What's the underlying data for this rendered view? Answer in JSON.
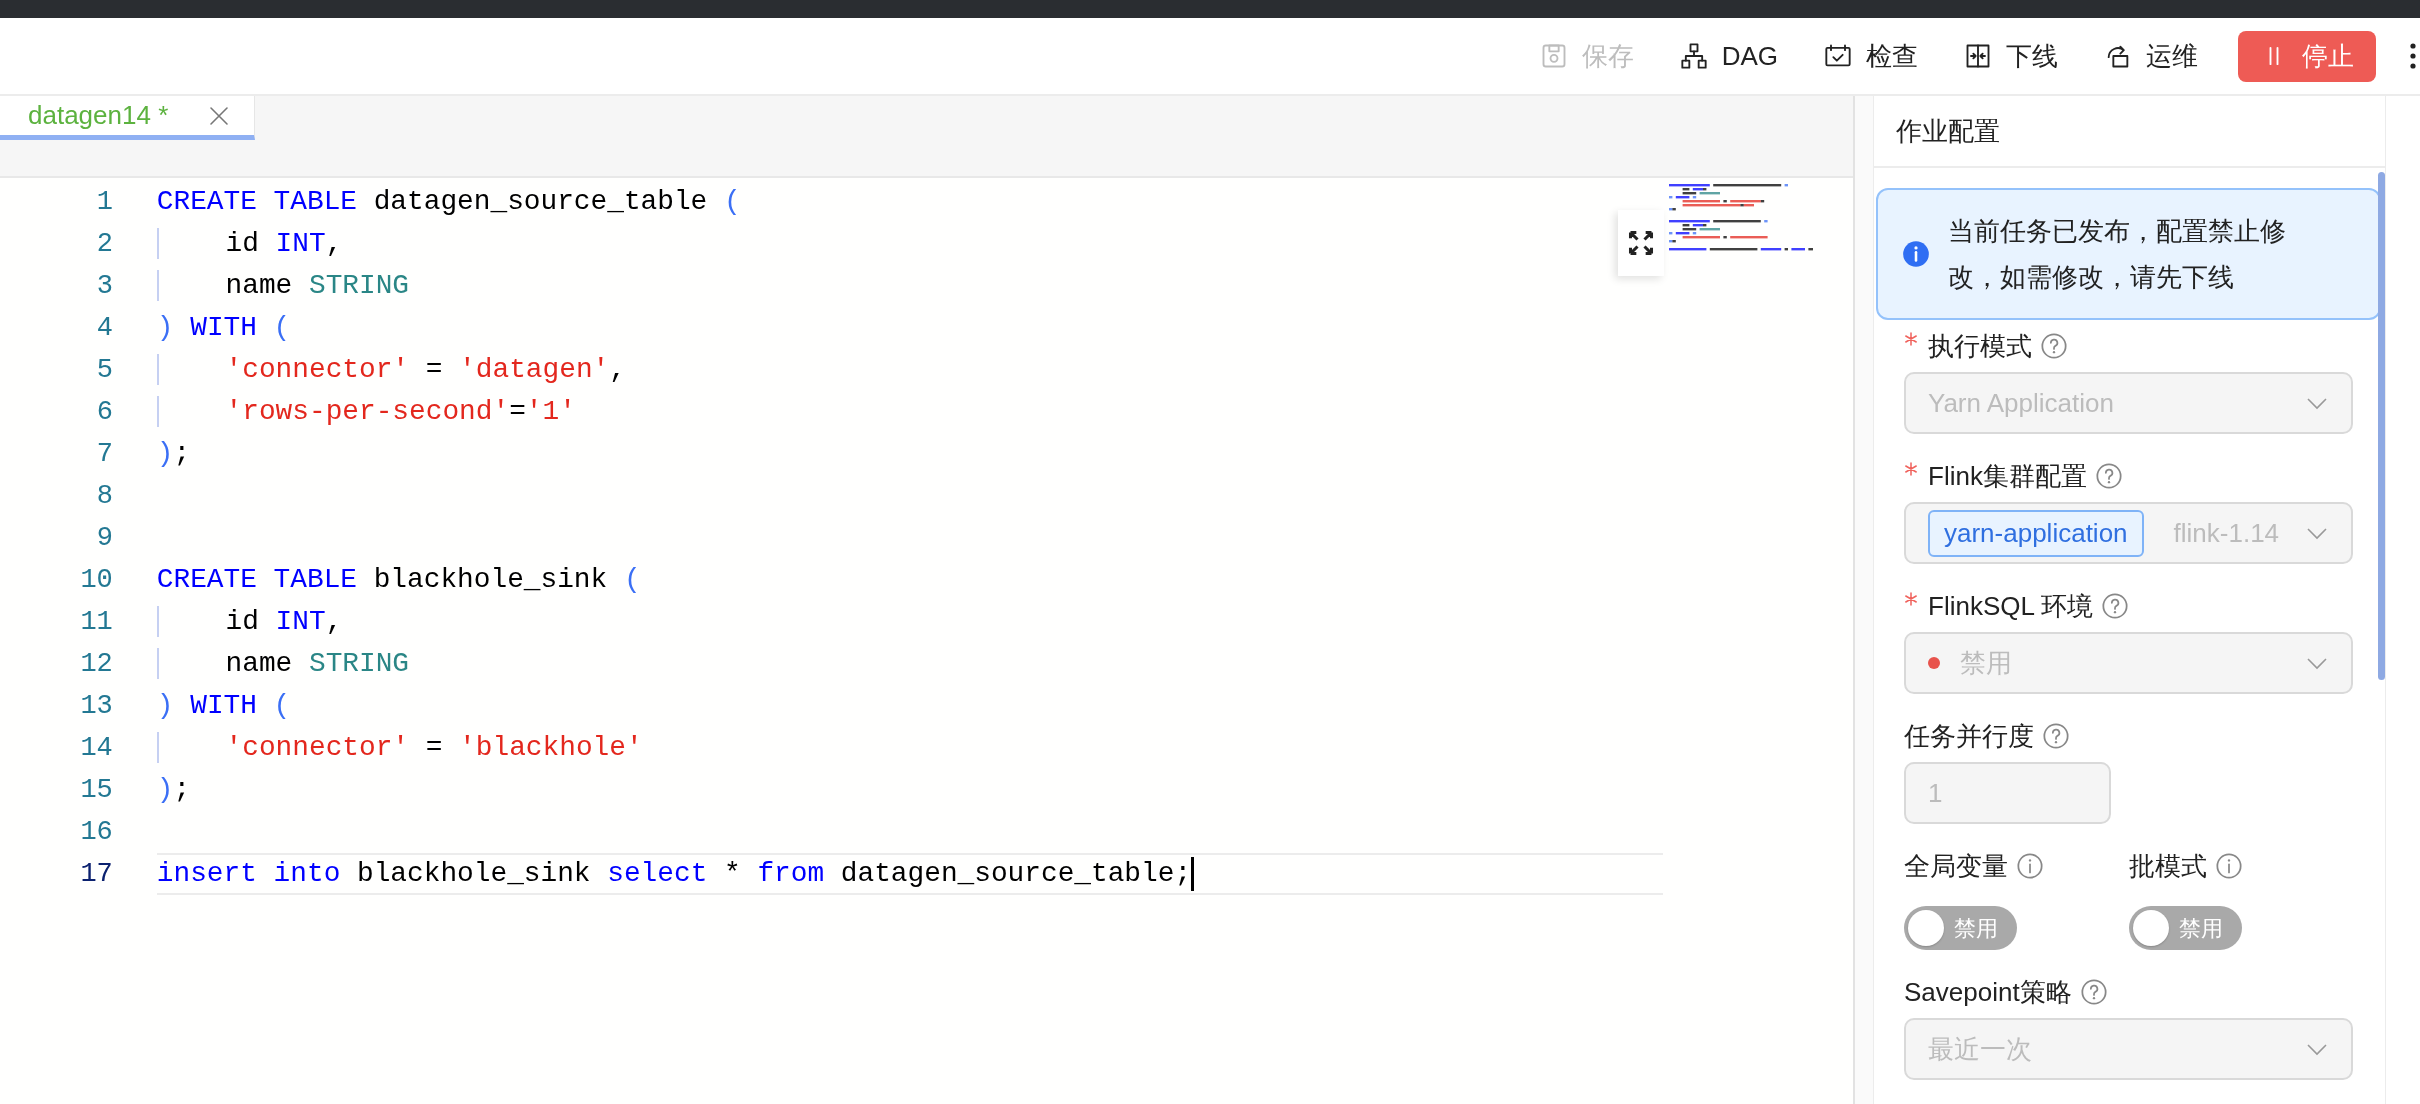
{
  "toolbar": {
    "buttons": [
      {
        "label": "保存",
        "disabled": true,
        "kind": "plain"
      },
      {
        "label": "DAG",
        "disabled": false,
        "kind": "plain"
      },
      {
        "label": "检查",
        "disabled": false,
        "kind": "plain"
      },
      {
        "label": "下线",
        "disabled": false,
        "kind": "plain"
      },
      {
        "label": "运维",
        "disabled": false,
        "kind": "plain"
      },
      {
        "label": "停止",
        "disabled": false,
        "kind": "danger"
      }
    ]
  },
  "tabs": [
    {
      "label": "datagen14 *",
      "selected": true
    }
  ],
  "editor": {
    "lines": [
      {
        "number": "1",
        "selected": false,
        "tokens": [
          {
            "text": "CREATE TABLE",
            "kind": "keyword"
          },
          {
            "text": " datagen_source_table ",
            "kind": "plain"
          },
          {
            "text": "(",
            "kind": "paren"
          }
        ]
      },
      {
        "number": "2",
        "selected": false,
        "tokens": [
          {
            "text": "    id ",
            "kind": "plain"
          },
          {
            "text": "INT",
            "kind": "keyword"
          },
          {
            "text": ",",
            "kind": "plain"
          }
        ]
      },
      {
        "number": "3",
        "selected": false,
        "tokens": [
          {
            "text": "    name ",
            "kind": "plain"
          },
          {
            "text": "STRING",
            "kind": "type"
          }
        ]
      },
      {
        "number": "4",
        "selected": false,
        "tokens": [
          {
            "text": ") ",
            "kind": "paren"
          },
          {
            "text": "WITH ",
            "kind": "keyword"
          },
          {
            "text": "(",
            "kind": "paren"
          }
        ]
      },
      {
        "number": "5",
        "selected": false,
        "tokens": [
          {
            "text": "    'connector'",
            "kind": "string"
          },
          {
            "text": " = ",
            "kind": "plain"
          },
          {
            "text": "'datagen'",
            "kind": "string"
          },
          {
            "text": ",",
            "kind": "plain"
          }
        ]
      },
      {
        "number": "6",
        "selected": false,
        "tokens": [
          {
            "text": "    'rows-per-second'",
            "kind": "string"
          },
          {
            "text": "=",
            "kind": "plain"
          },
          {
            "text": "'1'",
            "kind": "string"
          }
        ]
      },
      {
        "number": "7",
        "selected": false,
        "tokens": [
          {
            "text": ")",
            "kind": "paren"
          },
          {
            "text": ";",
            "kind": "plain"
          }
        ]
      },
      {
        "number": "8",
        "selected": false
      },
      {
        "number": "9",
        "selected": false
      },
      {
        "number": "10",
        "selected": false,
        "tokens": [
          {
            "text": "CREATE TABLE",
            "kind": "keyword"
          },
          {
            "text": " blackhole_sink ",
            "kind": "plain"
          },
          {
            "text": "(",
            "kind": "paren"
          }
        ]
      },
      {
        "number": "11",
        "selected": false,
        "tokens": [
          {
            "text": "    id ",
            "kind": "plain"
          },
          {
            "text": "INT",
            "kind": "keyword"
          },
          {
            "text": ",",
            "kind": "plain"
          }
        ]
      },
      {
        "number": "12",
        "selected": false,
        "tokens": [
          {
            "text": "    name ",
            "kind": "plain"
          },
          {
            "text": "STRING",
            "kind": "type"
          }
        ]
      },
      {
        "number": "13",
        "selected": false,
        "tokens": [
          {
            "text": ") ",
            "kind": "paren"
          },
          {
            "text": "WITH ",
            "kind": "keyword"
          },
          {
            "text": "(",
            "kind": "paren"
          }
        ]
      },
      {
        "number": "14",
        "selected": false,
        "tokens": [
          {
            "text": "    'connector'",
            "kind": "string"
          },
          {
            "text": " = ",
            "kind": "plain"
          },
          {
            "text": "'blackhole'",
            "kind": "string"
          }
        ]
      },
      {
        "number": "15",
        "selected": false,
        "tokens": [
          {
            "text": ")",
            "kind": "paren"
          },
          {
            "text": ";",
            "kind": "plain"
          }
        ]
      },
      {
        "number": "16",
        "selected": false
      },
      {
        "number": "17",
        "selected": true,
        "tokens": [
          {
            "text": "insert into",
            "kind": "keyword"
          },
          {
            "text": " blackhole_sink ",
            "kind": "plain"
          },
          {
            "text": "select",
            "kind": "keyword"
          },
          {
            "text": " * ",
            "kind": "plain"
          },
          {
            "text": "from",
            "kind": "keyword"
          },
          {
            "text": " datagen_source_table;",
            "kind": "plain"
          }
        ]
      }
    ]
  },
  "panel": {
    "title": "作业配置",
    "alert": "当前任务已发布，配置禁止修改，如需修改，请先下线",
    "fields": [
      {
        "kind": "select",
        "label": "执行模式",
        "required": true,
        "disabled": true,
        "value": "Yarn Application"
      },
      {
        "kind": "select",
        "label": "Flink集群配置",
        "required": true,
        "disabled": true,
        "tag": "yarn-application",
        "value": "flink-1.14"
      },
      {
        "kind": "select",
        "label": "FlinkSQL 环境",
        "required": true,
        "disabled": true,
        "value": "禁用",
        "color": "#e8534c"
      },
      {
        "kind": "input",
        "label": "任务并行度",
        "required": false,
        "disabled": true,
        "value": "1"
      },
      {
        "kind": "switches",
        "items": [
          {
            "label": "全局变量",
            "on": false,
            "text": "禁用"
          },
          {
            "label": "批模式",
            "on": false,
            "text": "禁用"
          }
        ]
      },
      {
        "kind": "select",
        "label": "Savepoint策略",
        "required": false,
        "disabled": true,
        "value": "最近一次"
      }
    ]
  }
}
